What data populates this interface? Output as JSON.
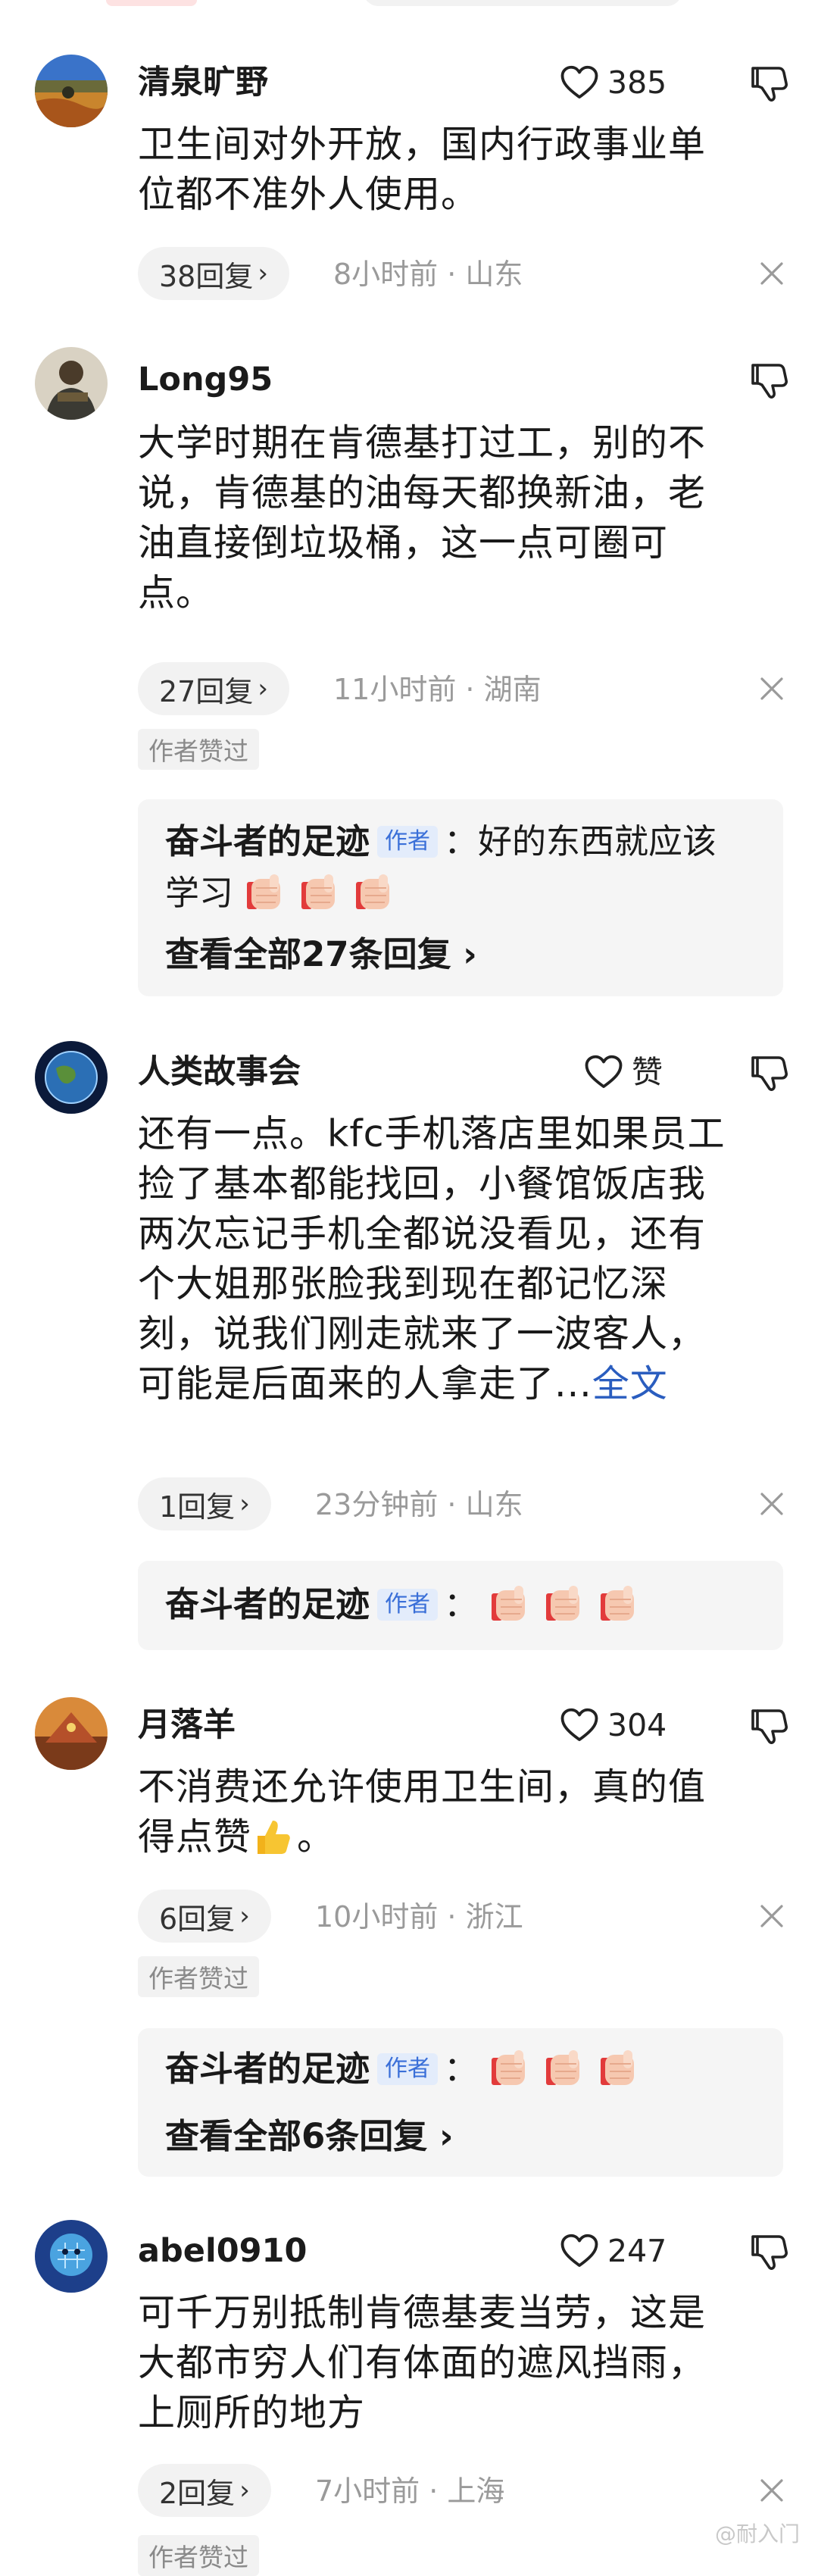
{
  "comments": [
    {
      "user": "清泉旷野",
      "likes": "385",
      "lines": [
        "卫生间对外开放，国内行政事业单",
        "位都不准外人使用。"
      ],
      "replies_label": "38回复",
      "meta": "8小时前 · 山东"
    },
    {
      "user": "Long95",
      "lines": [
        "大学时期在肯德基打过工，别的不",
        "说，肯德基的油每天都换新油，老",
        "油直接倒垃圾桶，这一点可圈可",
        "点。"
      ],
      "replies_label": "27回复",
      "meta": "11小时前 · 湖南",
      "author_liked": "作者赞过",
      "reply_author": "奋斗者的足迹",
      "author_tag": "作者",
      "reply_text_1": "：好的东西就应该",
      "reply_text_2": "学习",
      "see_all": "查看全部27条回复"
    },
    {
      "user": "人类故事会",
      "likes": "赞",
      "lines": [
        "还有一点。kfc手机落店里如果员工",
        "捡了基本都能找回，小餐馆饭店我",
        "两次忘记手机全都说没看见，还有",
        "个大姐那张脸我到现在都记忆深",
        "刻，说我们刚走就来了一波客人，"
      ],
      "last_line": "可能是后面来的人拿走了...",
      "more_label": "全文",
      "replies_label": "1回复",
      "meta": "23分钟前 · 山东",
      "reply_author": "奋斗者的足迹",
      "author_tag": "作者",
      "reply_colon": "："
    },
    {
      "user": "月落羊",
      "likes": "304",
      "lines": [
        "不消费还允许使用卫生间，真的值"
      ],
      "last_line": "得点赞",
      "last_line_end": "。",
      "replies_label": "6回复",
      "meta": "10小时前 · 浙江",
      "author_liked": "作者赞过",
      "reply_author": "奋斗者的足迹",
      "author_tag": "作者",
      "reply_colon": "：",
      "see_all": "查看全部6条回复"
    },
    {
      "user": "abel0910",
      "likes": "247",
      "lines": [
        "可千万别抵制肯德基麦当劳，这是",
        "大都市穷人们有体面的遮风挡雨，",
        "上厕所的地方"
      ],
      "replies_label": "2回复",
      "meta": "7小时前 · 上海",
      "author_liked": "作者赞过"
    }
  ],
  "watermark": "@耐入门",
  "colors": {
    "link": "#2a5dbf",
    "author_tag_bg": "#e3ecfb",
    "pill_bg": "#f2f2f2",
    "meta": "#9a9a9a"
  },
  "icons": [
    "heart-icon",
    "thumb-down-icon",
    "close-icon",
    "chevron-right-icon",
    "clapping-hand-emoji",
    "thumbs-up-emoji"
  ]
}
